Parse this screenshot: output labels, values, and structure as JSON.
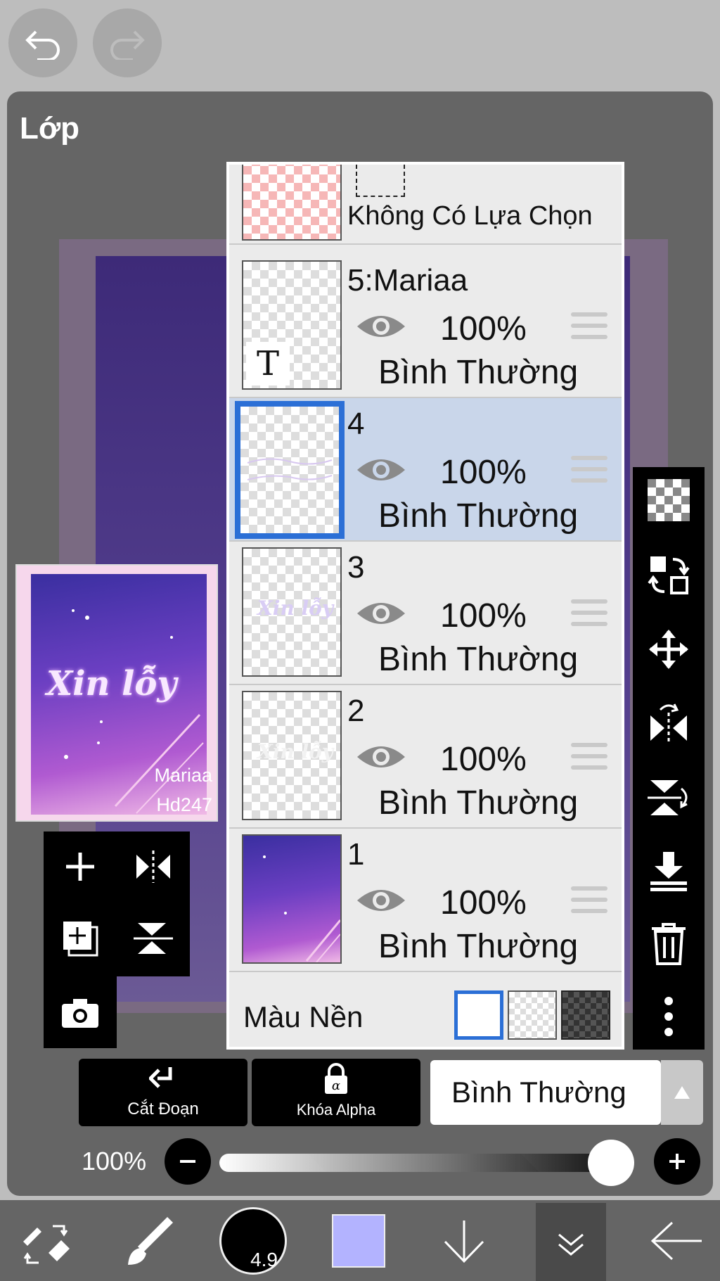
{
  "app": {
    "panel_title": "Lớp"
  },
  "artwork": {
    "title_text": "Xin lỗy",
    "signature_line1": "Mariaa",
    "signature_line2": "Hd247"
  },
  "layers": {
    "selection_label": "Không Có Lựa Chọn",
    "items": [
      {
        "name": "5:Mariaa",
        "opacity": "100%",
        "mode": "Bình Thường",
        "selected": false,
        "thumb_glyph": "T"
      },
      {
        "name": "4",
        "opacity": "100%",
        "mode": "Bình Thường",
        "selected": true
      },
      {
        "name": "3",
        "opacity": "100%",
        "mode": "Bình Thường",
        "selected": false
      },
      {
        "name": "2",
        "opacity": "100%",
        "mode": "Bình Thường",
        "selected": false
      },
      {
        "name": "1",
        "opacity": "100%",
        "mode": "Bình Thường",
        "selected": false
      }
    ],
    "background_label": "Màu Nền"
  },
  "controls": {
    "clipping_label": "Cắt Đoạn",
    "alpha_lock_label": "Khóa Alpha",
    "blend_mode": "Bình Thường",
    "opacity_label": "100%",
    "opacity_value": 1.0,
    "brush_size": "4.9",
    "current_color": "#b3b3ff"
  },
  "colors": {
    "selection_blue": "#2b6fd6",
    "selected_row": "#c9d6ea"
  }
}
